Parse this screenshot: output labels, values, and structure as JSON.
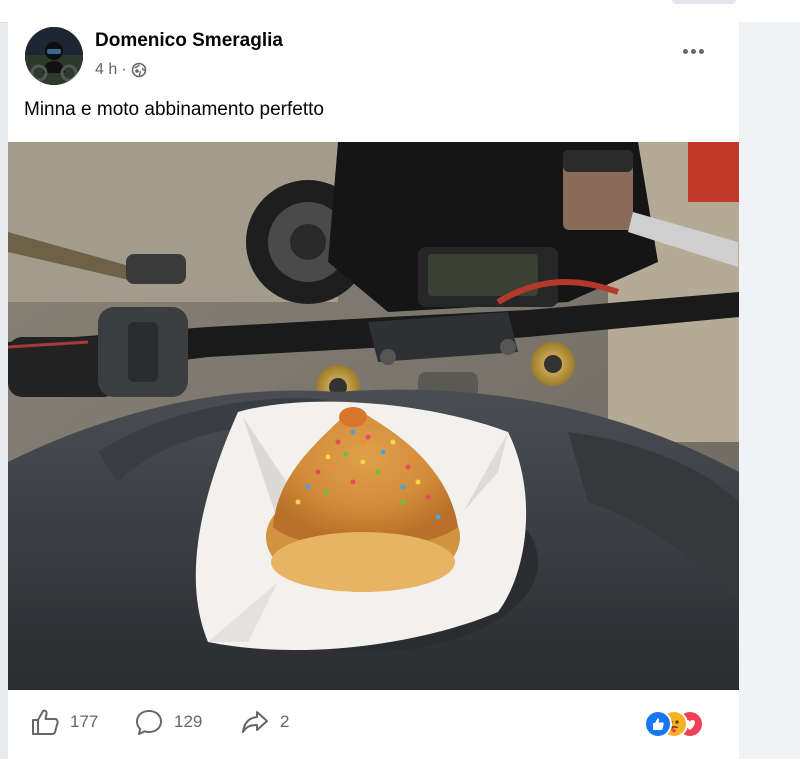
{
  "post": {
    "author": "Domenico Smeraglia",
    "time": "4 h",
    "separator": "·",
    "text": "Minna e moto abbinamento perfetto"
  },
  "icons": {
    "privacy": "globe-icon",
    "more": "more-options-icon",
    "like": "thumbs-up-icon",
    "comment": "comment-bubble-icon",
    "share": "share-arrow-icon"
  },
  "actions": {
    "likes": "177",
    "comments": "129",
    "shares": "2"
  },
  "reactions": [
    "like",
    "care",
    "love"
  ],
  "colors": {
    "like_blue": "#1877f2",
    "love_red": "#f33e58",
    "care_yellow": "#f7b125",
    "text_secondary": "#65676b"
  }
}
